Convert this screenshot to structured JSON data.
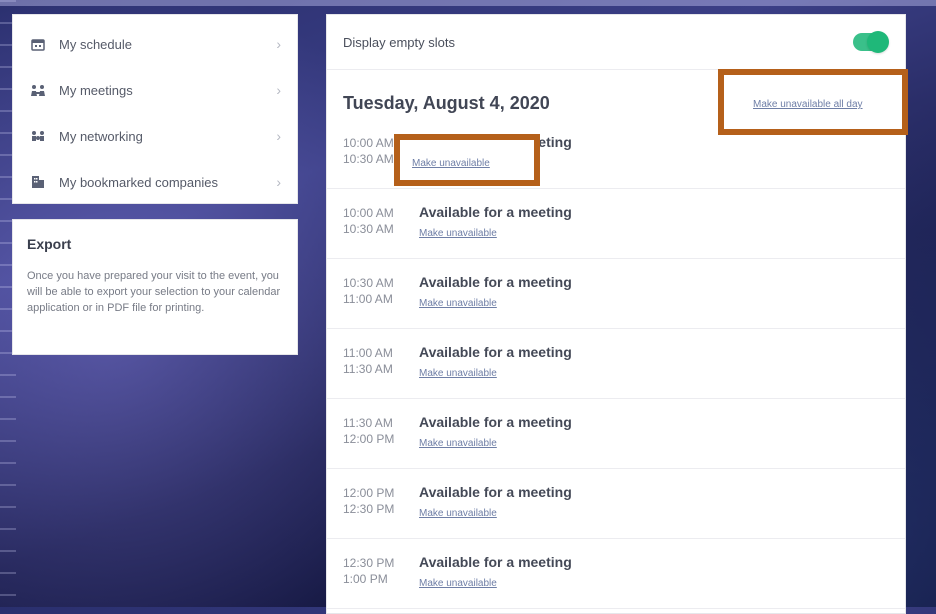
{
  "sidebar": {
    "items": [
      {
        "label": "My schedule",
        "icon": "calendar-icon"
      },
      {
        "label": "My meetings",
        "icon": "meetings-icon"
      },
      {
        "label": "My networking",
        "icon": "networking-icon"
      },
      {
        "label": "My bookmarked companies",
        "icon": "companies-icon"
      }
    ],
    "chevron": "›"
  },
  "export": {
    "title": "Export",
    "text": "Once you have prepared your visit to the event, you will be able to export your selection to your calendar application or in PDF file for printing."
  },
  "main": {
    "toggle_label": "Display empty slots",
    "toggle_on": true,
    "date": "Tuesday, August 4, 2020",
    "all_day_link": "Make unavailable all day",
    "slots": [
      {
        "start": "10:00 AM",
        "end": "10:30 AM",
        "title": "Available for a meeting",
        "action": "Make unavailable"
      },
      {
        "start": "10:00 AM",
        "end": "10:30 AM",
        "title": "Available for a meeting",
        "action": "Make unavailable"
      },
      {
        "start": "10:30 AM",
        "end": "11:00 AM",
        "title": "Available for a meeting",
        "action": "Make unavailable"
      },
      {
        "start": "11:00 AM",
        "end": "11:30 AM",
        "title": "Available for a meeting",
        "action": "Make unavailable"
      },
      {
        "start": "11:30 AM",
        "end": "12:00 PM",
        "title": "Available for a meeting",
        "action": "Make unavailable"
      },
      {
        "start": "12:00 PM",
        "end": "12:30 PM",
        "title": "Available for a meeting",
        "action": "Make unavailable"
      },
      {
        "start": "12:30 PM",
        "end": "1:00 PM",
        "title": "Available for a meeting",
        "action": "Make unavailable"
      }
    ]
  },
  "colors": {
    "accent_green": "#1fb879",
    "annotation": "#b5601a",
    "link": "#6e7ea6"
  }
}
